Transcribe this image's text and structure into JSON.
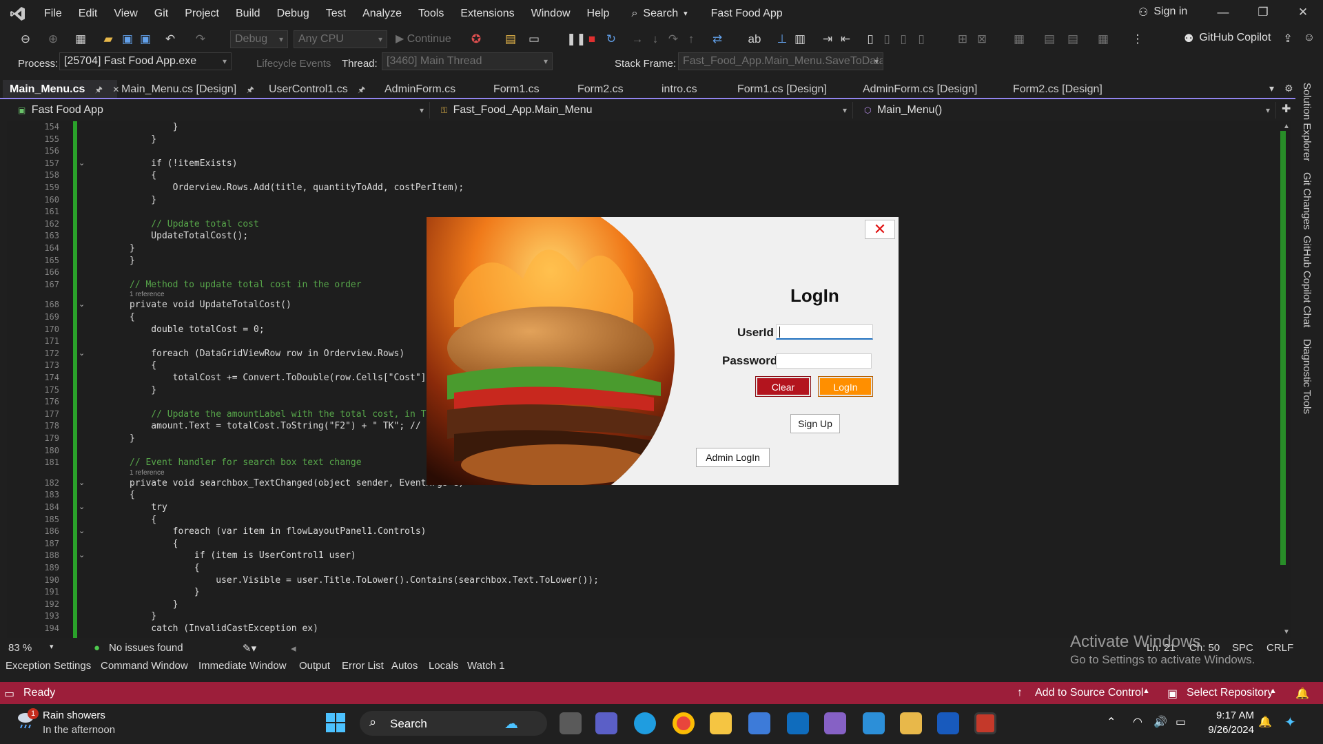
{
  "menubar": {
    "items": [
      "File",
      "Edit",
      "View",
      "Git",
      "Project",
      "Build",
      "Debug",
      "Test",
      "Analyze",
      "Tools",
      "Extensions",
      "Window",
      "Help"
    ],
    "search_label": "Search",
    "app_title": "Fast Food App",
    "sign_in": "Sign in"
  },
  "toolbar": {
    "config": "Debug",
    "platform": "Any CPU",
    "continue": "Continue",
    "copilot": "GitHub Copilot"
  },
  "process_bar": {
    "process_label": "Process:",
    "process_value": "[25704] Fast Food App.exe",
    "lifecycle": "Lifecycle Events",
    "thread_label": "Thread:",
    "thread_value": "[3460] Main Thread",
    "stack_label": "Stack Frame:",
    "stack_value": "Fast_Food_App.Main_Menu.SaveToDataba"
  },
  "tabs": [
    {
      "label": "Main_Menu.cs",
      "active": true
    },
    {
      "label": "Main_Menu.cs [Design]"
    },
    {
      "label": "UserControl1.cs"
    },
    {
      "label": "AdminForm.cs"
    },
    {
      "label": "Form1.cs"
    },
    {
      "label": "Form2.cs"
    },
    {
      "label": "intro.cs"
    },
    {
      "label": "Form1.cs [Design]"
    },
    {
      "label": "AdminForm.cs [Design]"
    },
    {
      "label": "Form2.cs [Design]"
    }
  ],
  "navbar": {
    "project": "Fast Food App",
    "class": "Fast_Food_App.Main_Menu",
    "member": "Main_Menu()"
  },
  "code_lines": [
    {
      "n": "154",
      "t": "        }"
    },
    {
      "n": "155",
      "t": "    }"
    },
    {
      "n": "156",
      "t": ""
    },
    {
      "n": "157",
      "t": "    if (!itemExists)"
    },
    {
      "n": "158",
      "t": "    {"
    },
    {
      "n": "159",
      "t": "        Orderview.Rows.Add(title, quantityToAdd, costPerItem);"
    },
    {
      "n": "160",
      "t": "    }"
    },
    {
      "n": "161",
      "t": ""
    },
    {
      "n": "162",
      "t": "    // Update total cost",
      "c": "comment"
    },
    {
      "n": "163",
      "t": "    UpdateTotalCost();"
    },
    {
      "n": "164",
      "t": "}"
    },
    {
      "n": "165",
      "t": "}"
    },
    {
      "n": "166",
      "t": ""
    },
    {
      "n": "167",
      "t": "// Method to update total cost in the order",
      "c": "comment"
    },
    {
      "n": "168",
      "t": "private void UpdateTotalCost()",
      "lens": "1 reference"
    },
    {
      "n": "169",
      "t": "{"
    },
    {
      "n": "170",
      "t": "    double totalCost = 0;"
    },
    {
      "n": "171",
      "t": ""
    },
    {
      "n": "172",
      "t": "    foreach (DataGridViewRow row in Orderview.Rows)"
    },
    {
      "n": "173",
      "t": "    {"
    },
    {
      "n": "174",
      "t": "        totalCost += Convert.ToDouble(row.Cells[\"Cost\"]"
    },
    {
      "n": "175",
      "t": "    }"
    },
    {
      "n": "176",
      "t": ""
    },
    {
      "n": "177",
      "t": "    // Update the amountLabel with the total cost, in T",
      "c": "comment"
    },
    {
      "n": "178",
      "t": "    amount.Text = totalCost.ToString(\"F2\") + \" TK\"; //"
    },
    {
      "n": "179",
      "t": "}"
    },
    {
      "n": "180",
      "t": ""
    },
    {
      "n": "181",
      "t": "// Event handler for search box text change",
      "c": "comment"
    },
    {
      "n": "182",
      "t": "private void searchbox_TextChanged(object sender, EventArgs e)",
      "lens": "1 reference"
    },
    {
      "n": "183",
      "t": "{"
    },
    {
      "n": "184",
      "t": "    try"
    },
    {
      "n": "185",
      "t": "    {"
    },
    {
      "n": "186",
      "t": "        foreach (var item in flowLayoutPanel1.Controls)"
    },
    {
      "n": "187",
      "t": "        {"
    },
    {
      "n": "188",
      "t": "            if (item is UserControl1 user)"
    },
    {
      "n": "189",
      "t": "            {"
    },
    {
      "n": "190",
      "t": "                user.Visible = user.Title.ToLower().Contains(searchbox.Text.ToLower());"
    },
    {
      "n": "191",
      "t": "            }"
    },
    {
      "n": "192",
      "t": "        }"
    },
    {
      "n": "193",
      "t": "    }"
    },
    {
      "n": "194",
      "t": "    catch (InvalidCastException ex)"
    }
  ],
  "side_tabs": [
    "Solution Explorer",
    "Git Changes",
    "GitHub Copilot Chat",
    "Diagnostic Tools"
  ],
  "editor_status": {
    "zoom": "83 %",
    "issues": "No issues found",
    "line": "Ln: 21",
    "col": "Ch: 50",
    "spc": "SPC",
    "eol": "CRLF"
  },
  "bottom_tabs": [
    "Exception Settings",
    "Command Window",
    "Immediate Window",
    "Output",
    "Error List",
    "Autos",
    "Locals",
    "Watch 1"
  ],
  "statusbar": {
    "ready": "Ready",
    "source_control": "Add to Source Control",
    "repo": "Select Repository"
  },
  "watermark": {
    "line1": "Activate Windows",
    "line2": "Go to Settings to activate Windows."
  },
  "taskbar": {
    "weather_title": "Rain showers",
    "weather_sub": "In the afternoon",
    "weather_badge": "1",
    "search": "Search",
    "time": "9:17 AM",
    "date": "9/26/2024"
  },
  "login_form": {
    "title": "LogIn",
    "userid_label": "UserId",
    "password_label": "Password",
    "clear": "Clear",
    "login": "LogIn",
    "signup": "Sign Up",
    "admin_login": "Admin LogIn",
    "close": "✕"
  },
  "colors": {
    "accent": "#9184ee",
    "statusbar": "#9c1e3a",
    "gutter_changed": "#2aa12a",
    "clear_button": "#b3141e",
    "login_button": "#ff8f00"
  }
}
